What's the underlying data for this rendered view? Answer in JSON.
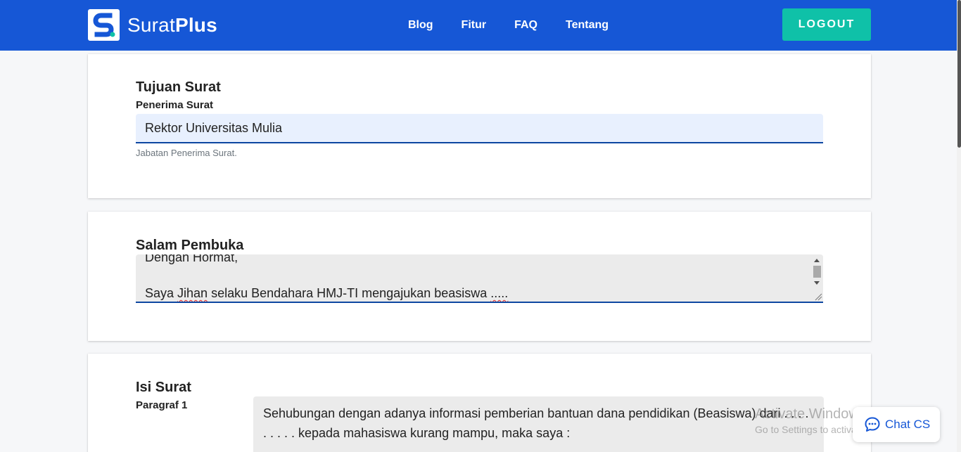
{
  "brand": {
    "name_regular": "Surat",
    "name_bold": "Plus"
  },
  "nav": [
    {
      "label": "Blog"
    },
    {
      "label": "Fitur"
    },
    {
      "label": "FAQ"
    },
    {
      "label": "Tentang"
    }
  ],
  "logout_label": "LOGOUT",
  "tujuan": {
    "title": "Tujuan Surat",
    "field_label": "Penerima Surat",
    "value": "Rektor Universitas Mulia",
    "help": "Jabatan Penerima Surat."
  },
  "salam": {
    "title": "Salam Pembuka",
    "line1": "Dengan Hormat,",
    "line2_pre": "Saya ",
    "line2_spell": "Jihan",
    "line2_mid": " selaku Bendahara HMJ-TI mengajukan beasiswa ",
    "line2_end": "....."
  },
  "isi": {
    "title": "Isi Surat",
    "para_label": "Paragraf 1",
    "para_text": "Sehubungan dengan adanya informasi pemberian bantuan dana pendidikan (Beasiswa) dari . . . . . . . . . kepada mahasiswa kurang mampu, maka saya :"
  },
  "watermark": {
    "line1": "Activate Windows",
    "line2": "Go to Settings to activate Windows."
  },
  "chat_label": "Chat CS",
  "colors": {
    "primary": "#1657d6",
    "accent": "#0fc1a8",
    "input_border": "#0d47a1"
  }
}
